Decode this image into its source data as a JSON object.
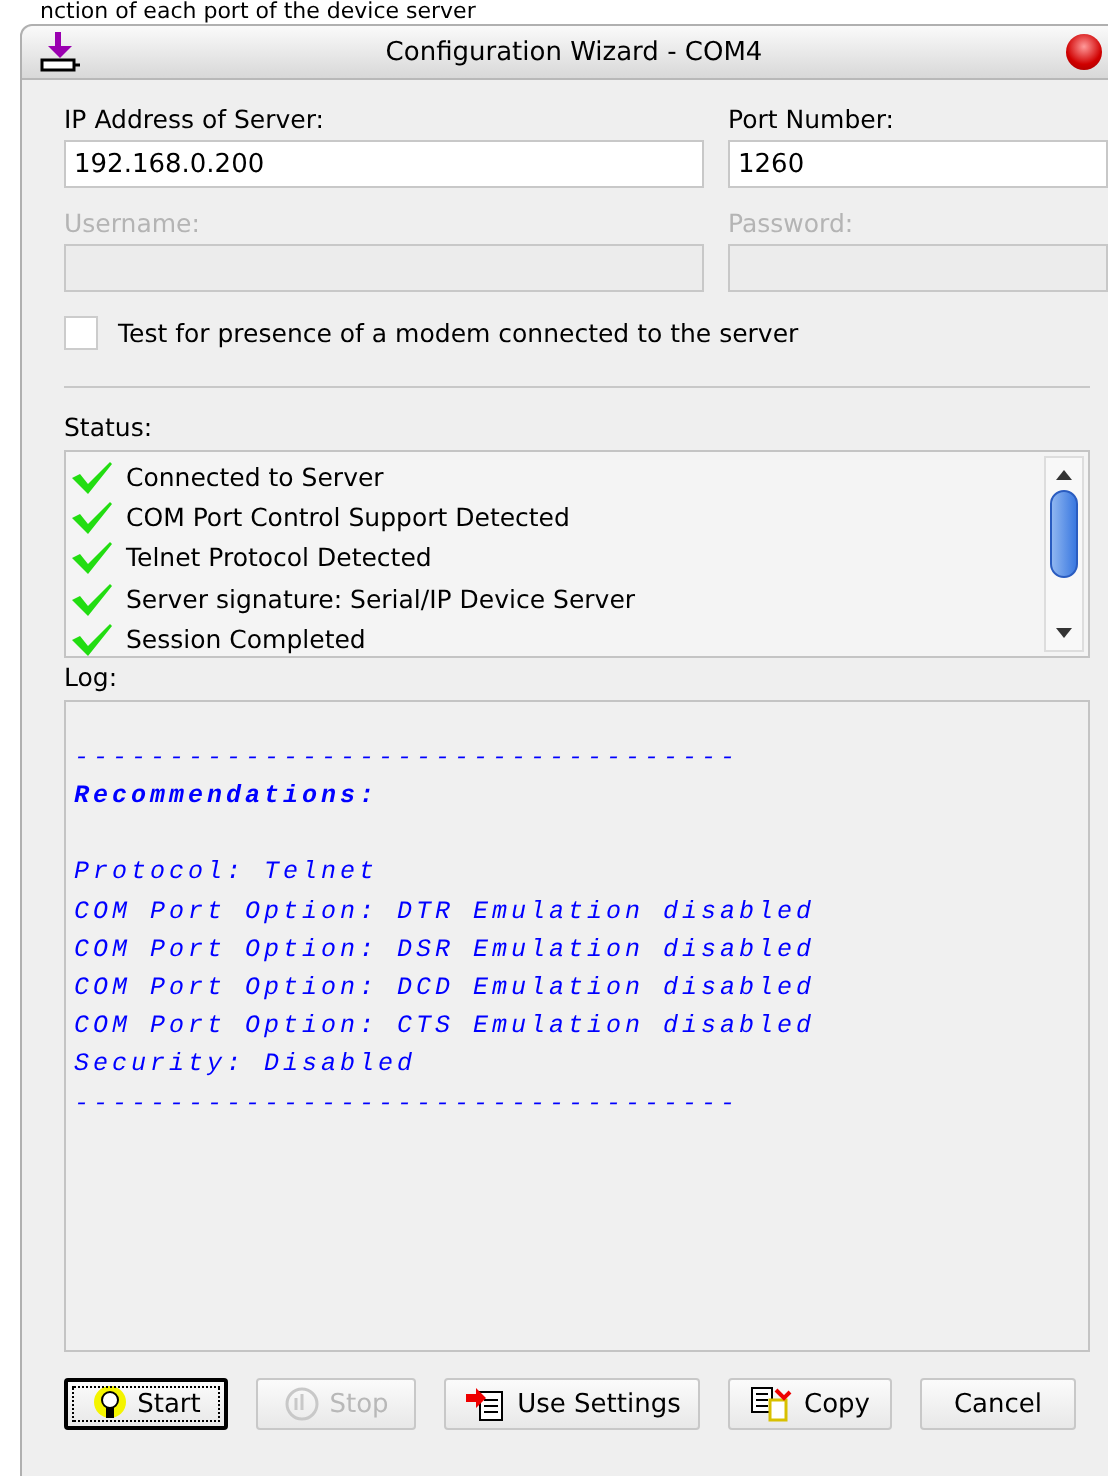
{
  "background_text": "nction of each port of the device server",
  "window": {
    "title": "Configuration Wizard - COM4"
  },
  "fields": [
    {
      "label": "IP Address of Server:",
      "value": "192.168.0.200",
      "disabled": false
    },
    {
      "label": "Port Number:",
      "value": "1260",
      "disabled": false
    },
    {
      "label": "Username:",
      "disabled": true
    },
    {
      "label": "Password:",
      "disabled": true
    }
  ],
  "modem_checkbox": {
    "label": "Test for presence of a modem connected to the server",
    "checked": false
  },
  "status": {
    "label": "Status:",
    "items": [
      {
        "text": "Connected to Server",
        "ok": true
      },
      {
        "text": "COM Port Control Support Detected",
        "ok": true
      },
      {
        "text": "Telnet Protocol Detected",
        "ok": true
      },
      {
        "text": "Server signature: Serial/IP Device Server",
        "ok": true
      },
      {
        "text": "Session Completed",
        "ok": true
      }
    ]
  },
  "log": {
    "label": "Log:",
    "lines": [
      {
        "kind": "rule",
        "text": "-----------------------------------"
      },
      {
        "kind": "heading",
        "text": "Recommendations:"
      },
      {
        "kind": "text",
        "text": "Protocol: Telnet"
      },
      {
        "kind": "text",
        "text": "COM Port Option: DTR Emulation disabled"
      },
      {
        "kind": "text",
        "text": "COM Port Option: DSR Emulation disabled"
      },
      {
        "kind": "text",
        "text": "COM Port Option: DCD Emulation disabled"
      },
      {
        "kind": "text",
        "text": "COM Port Option: CTS Emulation disabled"
      },
      {
        "kind": "text",
        "text": "Security: Disabled"
      },
      {
        "kind": "rule",
        "text": "-----------------------------------"
      }
    ]
  },
  "buttons": [
    {
      "kind": "start",
      "label": "Start",
      "disabled": false,
      "focused": true
    },
    {
      "kind": "stop",
      "label": "Stop",
      "disabled": true,
      "focused": false
    },
    {
      "kind": "use",
      "label": "Use Settings",
      "disabled": false,
      "focused": false
    },
    {
      "kind": "copy",
      "label": "Copy",
      "disabled": false,
      "focused": false
    },
    {
      "kind": "cancel",
      "label": "Cancel",
      "disabled": false,
      "focused": false
    }
  ]
}
